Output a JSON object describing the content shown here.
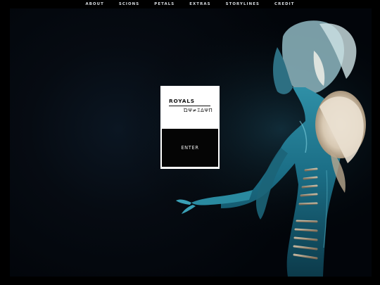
{
  "nav": {
    "items": [
      {
        "label": "ABOUT"
      },
      {
        "label": "SCIONS"
      },
      {
        "label": "PETALS"
      },
      {
        "label": "EXTRAS"
      },
      {
        "label": "STORYLINES"
      },
      {
        "label": "CREDIT"
      }
    ]
  },
  "card": {
    "title": "ROYALS",
    "glyph_subtitle": "ΏΨ≠ΞΔΨΠ",
    "enter_label": "ENTER"
  },
  "colors": {
    "background": "#000000",
    "card": "#ffffff",
    "button": "#050505",
    "figure_accent": "#2aa3b8"
  }
}
